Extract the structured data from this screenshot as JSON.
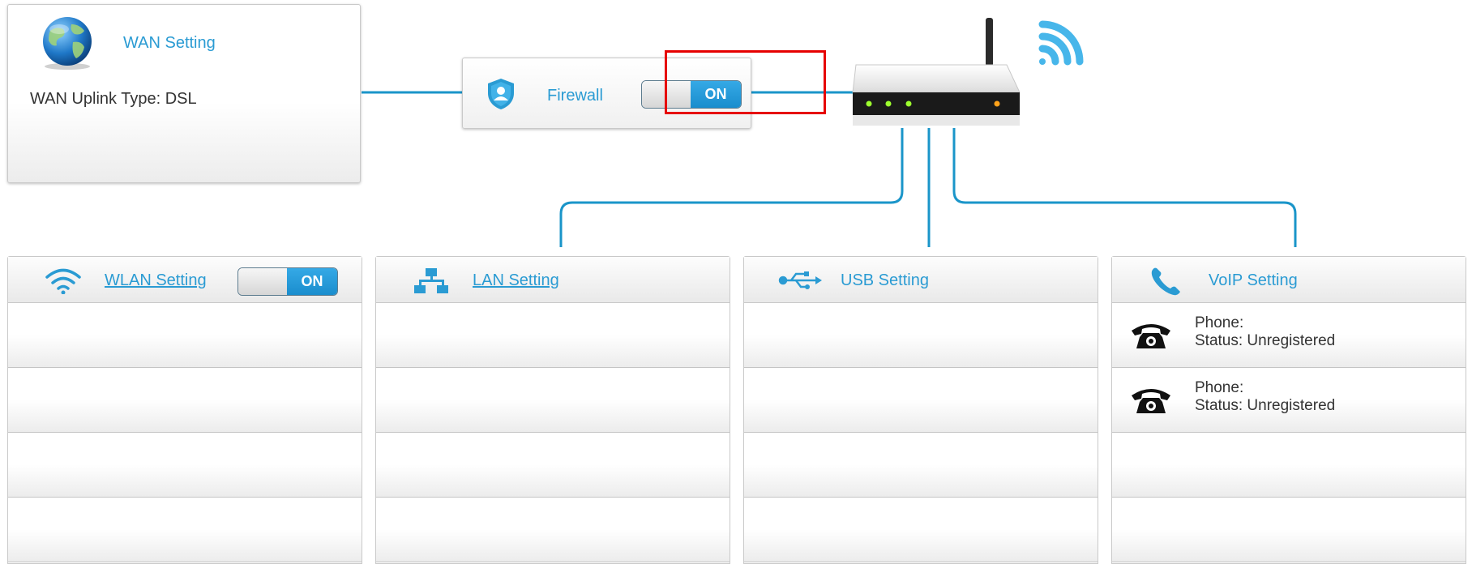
{
  "wan": {
    "title": "WAN Setting",
    "uplink": "WAN Uplink Type: DSL",
    "icon": "globe-icon"
  },
  "firewall": {
    "label": "Firewall",
    "toggle_state": "ON",
    "icon": "shield-user-icon"
  },
  "router": {
    "icon": "wireless-router-icon",
    "signal_icon": "wifi-signal-icon"
  },
  "panels": {
    "wlan": {
      "title": "WLAN Setting",
      "toggle_state": "ON",
      "icon": "wifi-icon"
    },
    "lan": {
      "title": "LAN Setting",
      "icon": "network-icon"
    },
    "usb": {
      "title": "USB Setting",
      "icon": "usb-icon"
    },
    "voip": {
      "title": "VoIP Setting",
      "icon": "phone-handset-icon",
      "lines": [
        {
          "phone": "Phone:",
          "status": "Status: Unregistered",
          "icon": "telephone-icon"
        },
        {
          "phone": "Phone:",
          "status": "Status: Unregistered",
          "icon": "telephone-icon"
        }
      ]
    }
  },
  "colors": {
    "accent": "#2a9bd3",
    "connector": "#1a95c9",
    "toggle_on": "#1a8dcd",
    "highlight": "#e60000"
  }
}
